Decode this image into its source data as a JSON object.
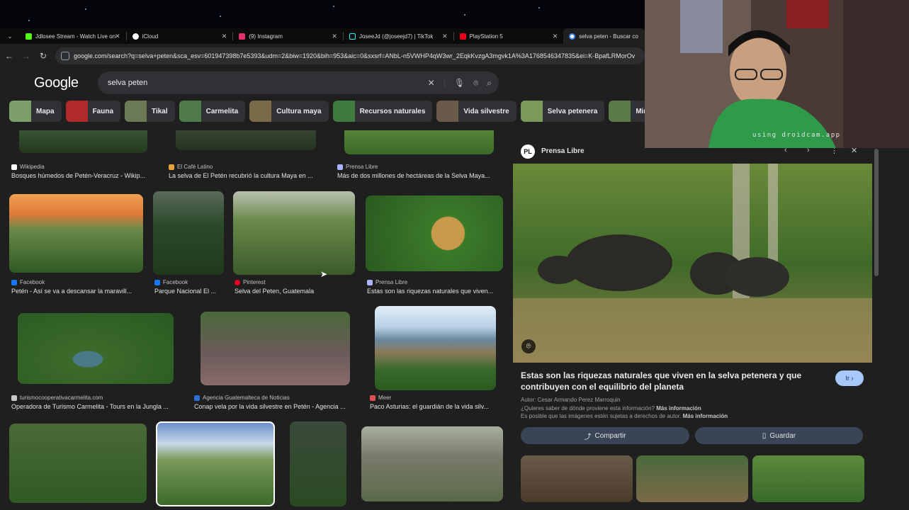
{
  "browser": {
    "tabs": [
      {
        "label": "Jdlosee Stream - Watch Live on",
        "color": "#53fc18"
      },
      {
        "label": "iCloud",
        "color": "#ffffff"
      },
      {
        "label": "(9) Instagram",
        "color": "#e1306c"
      },
      {
        "label": "JoseeJd (@joseejd7) | TikTok",
        "color": "#25f4ee"
      },
      {
        "label": "PlayStation 5",
        "color": "#e5001c"
      },
      {
        "label": "selva peten - Buscar co",
        "color": "#4285f4"
      }
    ],
    "url": "google.com/search?q=selva+peten&sca_esv=601947398b7e5393&udm=2&biw=1920&bih=953&aic=0&sxsrf=ANbL-n5VWHP4qW3wr_2EqkKvzgA3mgvk1A%3A1768546347835&ei=K-BpafLRMorOv"
  },
  "google": {
    "logo": "Google",
    "query": "selva peten",
    "chips": [
      {
        "label": "Mapa",
        "color": "#7da06a"
      },
      {
        "label": "Fauna",
        "color": "#b02a2a"
      },
      {
        "label": "Tikal",
        "color": "#6b7a55"
      },
      {
        "label": "Carmelita",
        "color": "#4f7a4a"
      },
      {
        "label": "Cultura maya",
        "color": "#7a6a4a"
      },
      {
        "label": "Recursos naturales",
        "color": "#3f7a3f"
      },
      {
        "label": "Vida silvestre",
        "color": "#6a5a4a"
      },
      {
        "label": "Selva petenera",
        "color": "#7a9a5a"
      },
      {
        "label": "Mirador",
        "color": "#5a7a4a"
      }
    ]
  },
  "results": {
    "row1": [
      {
        "source": "Wikipedia",
        "caption": "Bosques húmedos de Petén-Veracruz - Wikip...",
        "sicolor": "#ffffff"
      },
      {
        "source": "El Café Latino",
        "caption": "La selva de El Petén recubrió la cultura Maya en ...",
        "sicolor": "#e6a23c"
      },
      {
        "source": "Prensa Libre",
        "caption": "Más de dos millones de hectáreas de la Selva Maya...",
        "sicolor": "#aab4ff"
      }
    ],
    "row2": [
      {
        "source": "Facebook",
        "caption": "Petén - Así se va a descansar la maravill...",
        "sicolor": "#1877f2"
      },
      {
        "source": "Facebook",
        "caption": "Parque Nacional El ...",
        "sicolor": "#1877f2"
      },
      {
        "source": "Pinterest",
        "caption": "Selva del Peten, Guatemala",
        "sicolor": "#e60023"
      },
      {
        "source": "Prensa Libre",
        "caption": "Estas son las riquezas naturales que viven...",
        "sicolor": "#aab4ff"
      }
    ],
    "row3": [
      {
        "source": "turismocooperativacarmelita.com",
        "caption": "Operadora de Turismo Carmelita - Tours en la Jungla ...",
        "sicolor": "#c8c8c8"
      },
      {
        "source": "Agencia Guatemalteca de Noticias",
        "caption": "Conap vela por la vida silvestre en Petén - Agencia ...",
        "sicolor": "#2a6fd6"
      },
      {
        "source": "Meer",
        "caption": "Paco Asturias: el guardián de la vida silv...",
        "sicolor": "#e05050"
      }
    ]
  },
  "panel": {
    "source": "Prensa Libre",
    "logo_text": "PL",
    "title": "Estas son las riquezas naturales que viven en la selva petenera y que contribuyen con el equilibrio del planeta",
    "go_label": "Ir",
    "author": "Autor: Cesar Armando Perez Marroquin",
    "origin_q": "¿Quieres saber de dónde proviene esta información?",
    "origin_link": "Más información",
    "rights": "Es posible que las imágenes estén sujetas a derechos de autor.",
    "rights_link": "Más información",
    "share_label": "Compartir",
    "save_label": "Guardar"
  },
  "webcam": {
    "overlay_text": "using droidcam.app"
  }
}
